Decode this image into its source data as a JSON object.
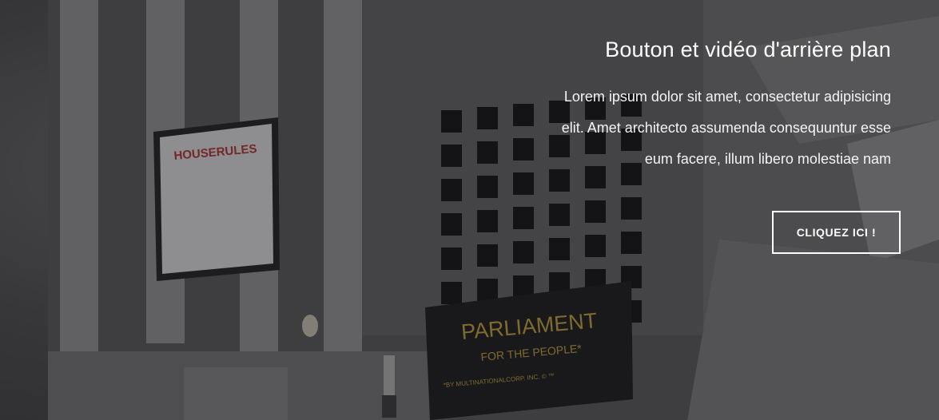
{
  "hero": {
    "title": "Bouton et vidéo d'arrière plan",
    "description_lines": [
      "Lorem ipsum dolor sit amet, consectetur adipisicing",
      "elit. Amet architecto assumenda consequuntur esse",
      "eum facere, illum libero molestiae nam"
    ],
    "button_label": "CLIQUEZ ICI !"
  },
  "background_video": {
    "houserules_sign": "HOUSERULES",
    "parliament_sign": {
      "line1": "PARLIAMENT",
      "line2": "FOR THE PEOPLE*",
      "line3": "*BY MULTINATIONALCORP. INC. © ™"
    }
  },
  "colors": {
    "text": "#ffffff",
    "button_border": "#ffffff",
    "sign_gold": "#b89a3a",
    "houserules_red": "#b03030"
  }
}
